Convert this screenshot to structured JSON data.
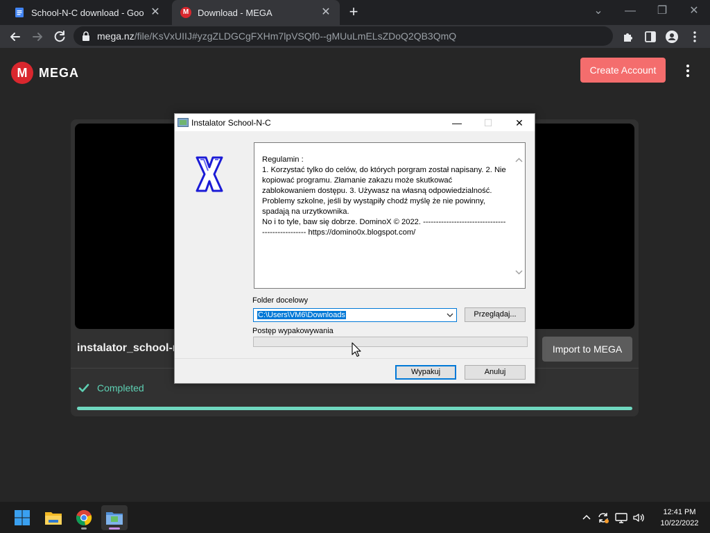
{
  "browser": {
    "tabs": [
      {
        "title": "School-N-C download - Google",
        "favicon": "google-docs-icon",
        "active": false
      },
      {
        "title": "Download - MEGA",
        "favicon": "mega-icon",
        "active": true
      }
    ],
    "url_host": "mega.nz",
    "url_path": "/file/KsVxUIIJ#yzgZLDGCgFXHm7lpVSQf0--gMUuLmELsZDoQ2QB3QmQ"
  },
  "mega": {
    "logo_letter": "M",
    "logo_text": "MEGA",
    "create_account": "Create Account",
    "file_name": "instalator_school-n-",
    "import_button": "Import to MEGA",
    "status": "Completed",
    "progress": 1.0,
    "accent_color": "#d9272e",
    "success_color": "#5ed1b4"
  },
  "dialog": {
    "title": "Instalator School-N-C",
    "terms_text": "Regulamin :\n1. Korzystać tylko do celów, do których porgram został napisany. 2. Nie kopiować programu. Złamanie zakazu może skutkować zablokowaniem dostępu. 3. Używasz na własną odpowiedzialność. Problemy szkolne, jeśli by wystąpiły chodź myślę że nie powinny, spadają na urzytkownika.\nNo i to tyle, baw się dobrze. DominoX © 2022. ------------------------------------------------- https://domino0x.blogspot.com/",
    "folder_label": "Folder docelowy",
    "folder_value": "C:\\Users\\VM6\\Downloads",
    "browse_button": "Przeglądaj...",
    "progress_label": "Postęp wypakowywania",
    "extract_progress": 0,
    "extract_button": "Wypakuj",
    "cancel_button": "Anuluj"
  },
  "taskbar": {
    "apps": [
      "windows-start-icon",
      "file-explorer-icon",
      "chrome-icon",
      "installer-icon"
    ],
    "time": "12:41 PM",
    "date": "10/22/2022"
  }
}
